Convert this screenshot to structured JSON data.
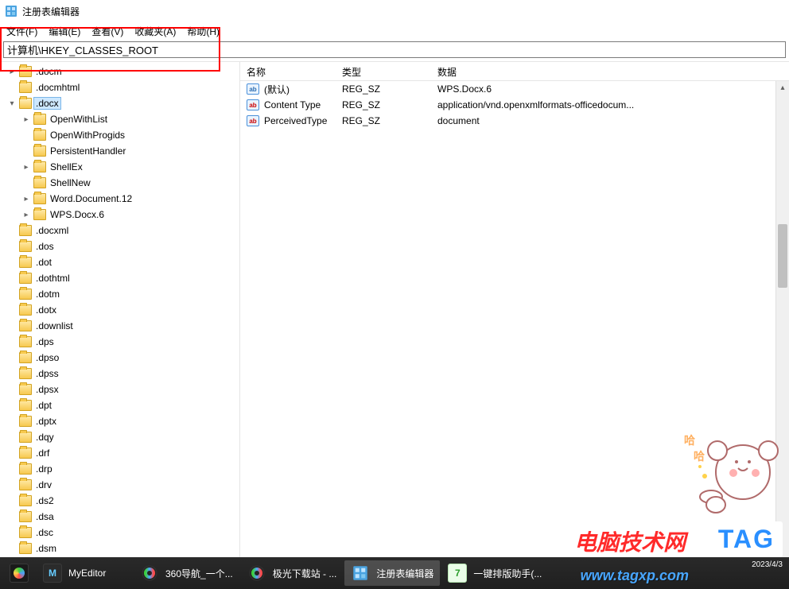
{
  "window": {
    "title": "注册表编辑器"
  },
  "menu": {
    "file": "文件(F)",
    "edit": "编辑(E)",
    "view": "查看(V)",
    "favorites": "收藏夹(A)",
    "help": "帮助(H)"
  },
  "address": "计算机\\HKEY_CLASSES_ROOT",
  "tree": [
    {
      "level": 1,
      "name": ".docm",
      "expand": "closed"
    },
    {
      "level": 1,
      "name": ".docmhtml",
      "expand": "none"
    },
    {
      "level": 1,
      "name": ".docx",
      "expand": "open",
      "selected": true
    },
    {
      "level": 2,
      "name": "OpenWithList",
      "expand": "closed"
    },
    {
      "level": 2,
      "name": "OpenWithProgids",
      "expand": "none"
    },
    {
      "level": 2,
      "name": "PersistentHandler",
      "expand": "none"
    },
    {
      "level": 2,
      "name": "ShellEx",
      "expand": "closed"
    },
    {
      "level": 2,
      "name": "ShellNew",
      "expand": "none"
    },
    {
      "level": 2,
      "name": "Word.Document.12",
      "expand": "closed"
    },
    {
      "level": 2,
      "name": "WPS.Docx.6",
      "expand": "closed"
    },
    {
      "level": 1,
      "name": ".docxml",
      "expand": "none"
    },
    {
      "level": 1,
      "name": ".dos",
      "expand": "none"
    },
    {
      "level": 1,
      "name": ".dot",
      "expand": "none"
    },
    {
      "level": 1,
      "name": ".dothtml",
      "expand": "none"
    },
    {
      "level": 1,
      "name": ".dotm",
      "expand": "none"
    },
    {
      "level": 1,
      "name": ".dotx",
      "expand": "none"
    },
    {
      "level": 1,
      "name": ".downlist",
      "expand": "none"
    },
    {
      "level": 1,
      "name": ".dps",
      "expand": "none"
    },
    {
      "level": 1,
      "name": ".dpso",
      "expand": "none"
    },
    {
      "level": 1,
      "name": ".dpss",
      "expand": "none"
    },
    {
      "level": 1,
      "name": ".dpsx",
      "expand": "none"
    },
    {
      "level": 1,
      "name": ".dpt",
      "expand": "none"
    },
    {
      "level": 1,
      "name": ".dptx",
      "expand": "none"
    },
    {
      "level": 1,
      "name": ".dqy",
      "expand": "none"
    },
    {
      "level": 1,
      "name": ".drf",
      "expand": "none"
    },
    {
      "level": 1,
      "name": ".drp",
      "expand": "none"
    },
    {
      "level": 1,
      "name": ".drv",
      "expand": "none"
    },
    {
      "level": 1,
      "name": ".ds2",
      "expand": "none"
    },
    {
      "level": 1,
      "name": ".dsa",
      "expand": "none"
    },
    {
      "level": 1,
      "name": ".dsc",
      "expand": "none"
    },
    {
      "level": 1,
      "name": ".dsm",
      "expand": "none"
    }
  ],
  "columns": {
    "name": "名称",
    "type": "类型",
    "data": "数据"
  },
  "values": [
    {
      "icon": "def",
      "name": "(默认)",
      "type": "REG_SZ",
      "data": "WPS.Docx.6"
    },
    {
      "icon": "str",
      "name": "Content Type",
      "type": "REG_SZ",
      "data": "application/vnd.openxmlformats-officedocum..."
    },
    {
      "icon": "str",
      "name": "PerceivedType",
      "type": "REG_SZ",
      "data": "document"
    }
  ],
  "taskbar": [
    {
      "icon": "lib",
      "kind": "lib",
      "label": ""
    },
    {
      "icon": "dark",
      "kind": "text",
      "text": "M",
      "label": "MyEditor"
    },
    {
      "icon": "chrome1",
      "kind": "ring",
      "label": "360导航_一个..."
    },
    {
      "icon": "chrome2",
      "kind": "ring",
      "label": "极光下载站 - ..."
    },
    {
      "icon": "reg",
      "kind": "reg",
      "label": "注册表编辑器",
      "active": true
    },
    {
      "icon": "green",
      "kind": "text",
      "text": "7",
      "label": "一键排版助手(..."
    }
  ],
  "tray": {
    "date": "2023/4/3"
  },
  "watermarks": {
    "w1": "电脑技术网",
    "w2": "TAG",
    "w3": "www.tagxp.com"
  }
}
